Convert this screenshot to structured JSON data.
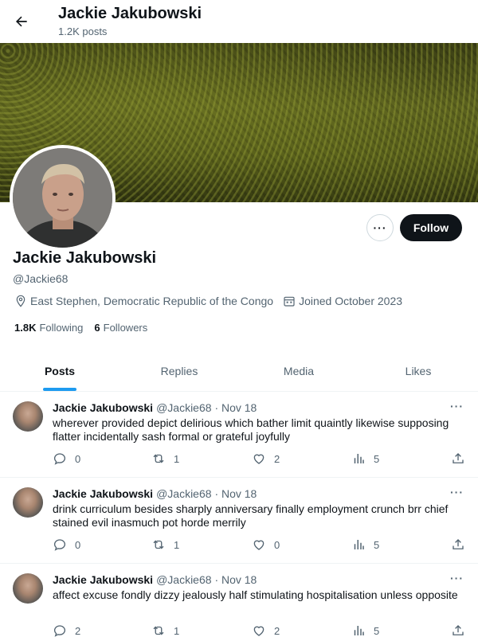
{
  "header": {
    "name": "Jackie Jakubowski",
    "post_count": "1.2K posts"
  },
  "profile": {
    "display_name": "Jackie Jakubowski",
    "handle": "@Jackie68",
    "location": "East Stephen, Democratic Republic of the Congo",
    "joined": "Joined October 2023",
    "following_count": "1.8K",
    "following_label": "Following",
    "followers_count": "6",
    "followers_label": "Followers",
    "more_label": "···",
    "follow_label": "Follow"
  },
  "tabs": [
    {
      "label": "Posts",
      "active": true
    },
    {
      "label": "Replies",
      "active": false
    },
    {
      "label": "Media",
      "active": false
    },
    {
      "label": "Likes",
      "active": false
    }
  ],
  "posts": [
    {
      "name": "Jackie Jakubowski",
      "handle": "@Jackie68",
      "date": "· Nov 18",
      "text": "wherever provided depict delirious which bather limit quaintly likewise supposing flatter incidentally sash formal or grateful joyfully",
      "replies": "0",
      "reposts": "1",
      "likes": "2",
      "views": "5"
    },
    {
      "name": "Jackie Jakubowski",
      "handle": "@Jackie68",
      "date": "· Nov 18",
      "text": "drink curriculum besides sharply anniversary finally employment crunch brr chief stained evil inasmuch pot horde merrily",
      "replies": "0",
      "reposts": "1",
      "likes": "0",
      "views": "5"
    },
    {
      "name": "Jackie Jakubowski",
      "handle": "@Jackie68",
      "date": "· Nov 18",
      "text": "affect excuse fondly dizzy jealously half stimulating hospitalisation unless opposite",
      "replies": "2",
      "reposts": "1",
      "likes": "2",
      "views": "5"
    }
  ],
  "post_more_label": "···",
  "colors": {
    "accent": "#1d9bf0",
    "follow_bg": "#0f1419",
    "secondary_text": "#536471"
  }
}
